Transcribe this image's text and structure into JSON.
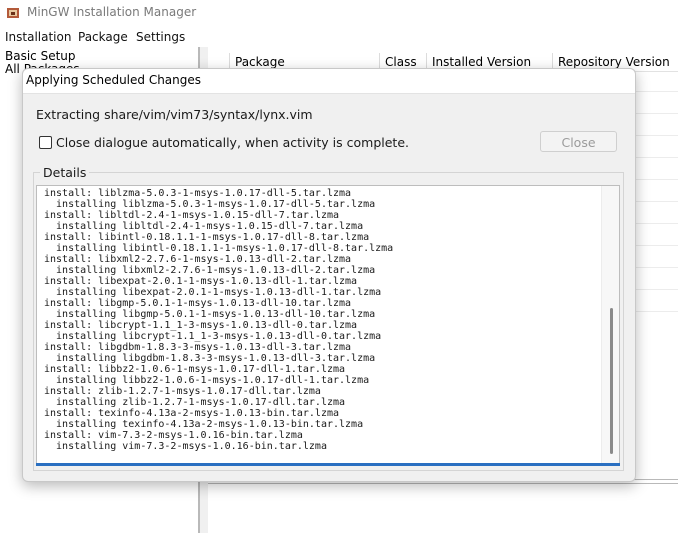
{
  "window": {
    "title": "MinGW Installation Manager"
  },
  "menu": {
    "installation": "Installation",
    "package": "Package",
    "settings": "Settings"
  },
  "sidebar": {
    "items": [
      {
        "label": "Basic Setup"
      },
      {
        "label": "All Packages"
      }
    ]
  },
  "package_list": {
    "columns": [
      {
        "label": ""
      },
      {
        "label": "Package"
      },
      {
        "label": "Class"
      },
      {
        "label": "Installed Version"
      },
      {
        "label": "Repository Version"
      }
    ]
  },
  "dialog": {
    "title": "Applying Scheduled Changes",
    "status": "Extracting share/vim/vim73/syntax/lynx.vim",
    "auto_close_label": "Close dialogue automatically, when activity is complete.",
    "auto_close_checked": false,
    "close_button": "Close",
    "details_label": "Details",
    "log": [
      "install: liblzma-5.0.3-1-msys-1.0.17-dll-5.tar.lzma",
      "  installing liblzma-5.0.3-1-msys-1.0.17-dll-5.tar.lzma",
      "install: libltdl-2.4-1-msys-1.0.15-dll-7.tar.lzma",
      "  installing libltdl-2.4-1-msys-1.0.15-dll-7.tar.lzma",
      "install: libintl-0.18.1.1-1-msys-1.0.17-dll-8.tar.lzma",
      "  installing libintl-0.18.1.1-1-msys-1.0.17-dll-8.tar.lzma",
      "install: libxml2-2.7.6-1-msys-1.0.13-dll-2.tar.lzma",
      "  installing libxml2-2.7.6-1-msys-1.0.13-dll-2.tar.lzma",
      "install: libexpat-2.0.1-1-msys-1.0.13-dll-1.tar.lzma",
      "  installing libexpat-2.0.1-1-msys-1.0.13-dll-1.tar.lzma",
      "install: libgmp-5.0.1-1-msys-1.0.13-dll-10.tar.lzma",
      "  installing libgmp-5.0.1-1-msys-1.0.13-dll-10.tar.lzma",
      "install: libcrypt-1.1_1-3-msys-1.0.13-dll-0.tar.lzma",
      "  installing libcrypt-1.1_1-3-msys-1.0.13-dll-0.tar.lzma",
      "install: libgdbm-1.8.3-3-msys-1.0.13-dll-3.tar.lzma",
      "  installing libgdbm-1.8.3-3-msys-1.0.13-dll-3.tar.lzma",
      "install: libbz2-1.0.6-1-msys-1.0.17-dll-1.tar.lzma",
      "  installing libbz2-1.0.6-1-msys-1.0.17-dll-1.tar.lzma",
      "install: zlib-1.2.7-1-msys-1.0.17-dll.tar.lzma",
      "  installing zlib-1.2.7-1-msys-1.0.17-dll.tar.lzma",
      "install: texinfo-4.13a-2-msys-1.0.13-bin.tar.lzma",
      "  installing texinfo-4.13a-2-msys-1.0.13-bin.tar.lzma",
      "install: vim-7.3-2-msys-1.0.16-bin.tar.lzma",
      "  installing vim-7.3-2-msys-1.0.16-bin.tar.lzma"
    ]
  },
  "icons": {
    "app": "mingw-app-icon",
    "checkbox": "checkbox-unchecked"
  },
  "colors": {
    "progress": "#2a6fc1",
    "dialog_bg": "#f0f0f0",
    "title_gray": "#7a7a7a"
  }
}
